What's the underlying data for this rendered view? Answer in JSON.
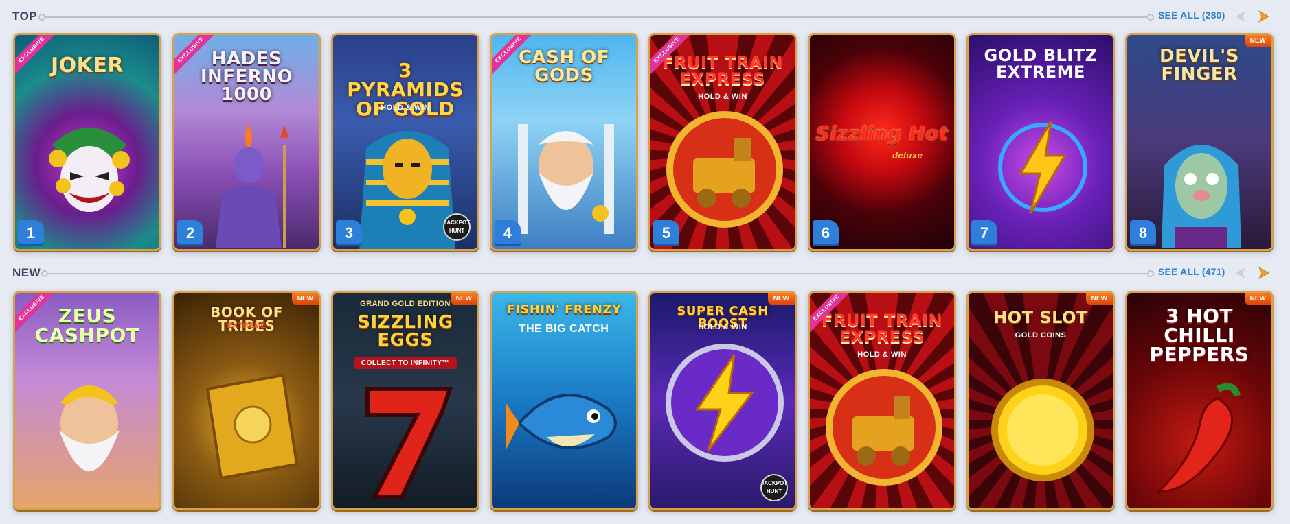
{
  "sections": {
    "top": {
      "title": "TOP",
      "see_all": "SEE ALL (280)",
      "games": [
        {
          "title": "JOKER",
          "sub": "",
          "rank": "1",
          "exclusive": "EXCLUSIVE"
        },
        {
          "title": "HADES INFERNO 1000",
          "sub": "",
          "rank": "2",
          "exclusive": "EXCLUSIVE"
        },
        {
          "title": "3 PYRAMIDS OF GOLD",
          "sub": "HOLD & WIN",
          "rank": "3",
          "jackpot": "JACKPOT HUNT"
        },
        {
          "title": "CASH OF GODS",
          "sub": "",
          "rank": "4",
          "exclusive": "EXCLUSIVE"
        },
        {
          "title": "FRUIT TRAIN EXPRESS",
          "sub": "HOLD & WIN",
          "rank": "5",
          "exclusive": "EXCLUSIVE"
        },
        {
          "title": "Sizzling Hot",
          "sub": "deluxe",
          "rank": "6"
        },
        {
          "title": "GOLD BLITZ EXTREME",
          "sub": "",
          "rank": "7"
        },
        {
          "title": "DEVIL'S FINGER",
          "sub": "",
          "rank": "8",
          "new": "NEW"
        }
      ]
    },
    "new": {
      "title": "NEW",
      "see_all": "SEE ALL (471)",
      "games": [
        {
          "title": "ZEUS CASHPOT",
          "sub": "",
          "exclusive": "EXCLUSIVE"
        },
        {
          "title": "BOOK OF TRIBES",
          "sub": "EXTREME",
          "new": "NEW"
        },
        {
          "title": "SIZZLING EGGS",
          "sub": "GRAND GOLD EDITION",
          "sub2": "COLLECT TO INFINITY™",
          "new": "NEW"
        },
        {
          "title": "FISHIN' FRENZY",
          "sub": "THE BIG CATCH"
        },
        {
          "title": "SUPER CASH BOOST",
          "sub": "HOLD & WIN",
          "new": "NEW",
          "jackpot": "JACKPOT HUNT"
        },
        {
          "title": "FRUIT TRAIN EXPRESS",
          "sub": "HOLD & WIN",
          "exclusive": "EXCLUSIVE"
        },
        {
          "title": "HOT SLOT",
          "sub": "GOLD COINS",
          "new": "NEW"
        },
        {
          "title": "3 HOT CHILLI PEPPERS",
          "sub": "",
          "new": "NEW"
        }
      ]
    }
  },
  "colors": {
    "background": "#e6eaf3",
    "section_title": "#3b4561",
    "link": "#2f7fd0",
    "card_border": "#d7a24a",
    "rank_badge": "#2e7fd9",
    "exclusive_ribbon": "#e0349b",
    "new_badge": "#ff7a1a"
  },
  "icons": {
    "prev": "arrow-left-icon",
    "next": "arrow-right-icon"
  }
}
